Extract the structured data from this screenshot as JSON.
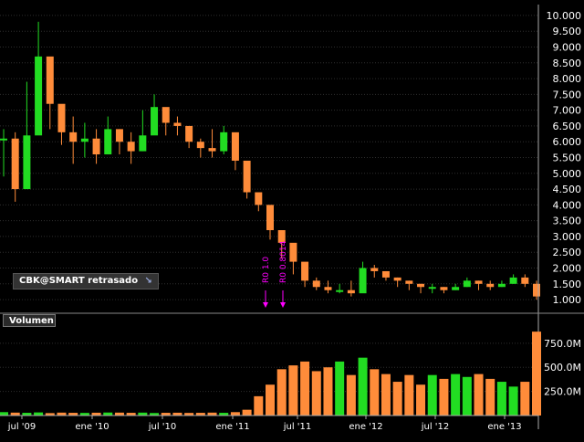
{
  "colors": {
    "up": "#22dd22",
    "down": "#ff8c3a",
    "grid": "#2e2e2e",
    "annotation": "#ff00ff",
    "axis": "#aaaaaa"
  },
  "symbol_badge": {
    "text": "CBK@SMART retrasado",
    "icon": "pointer-icon"
  },
  "volume_panel": {
    "title": "Volumen"
  },
  "chart_data": [
    {
      "type": "candlestick",
      "x_ticks": [
        "jul '09",
        "ene '10",
        "jul '10",
        "ene '11",
        "jul '11",
        "ene '12",
        "jul '12",
        "ene '13"
      ],
      "y_ticks": [
        "1.000",
        "1.500",
        "2.000",
        "2.500",
        "3.000",
        "3.500",
        "4.000",
        "4.500",
        "5.000",
        "5.500",
        "6.000",
        "6.500",
        "7.000",
        "7.500",
        "8.000",
        "8.500",
        "9.000",
        "9.500",
        "10.000"
      ],
      "ylim": [
        0.8,
        10.2
      ],
      "x": [
        "2009-05",
        "2009-06",
        "2009-07",
        "2009-08",
        "2009-09",
        "2009-10",
        "2009-11",
        "2009-12",
        "2010-01",
        "2010-02",
        "2010-03",
        "2010-04",
        "2010-05",
        "2010-06",
        "2010-07",
        "2010-08",
        "2010-09",
        "2010-10",
        "2010-11",
        "2010-12",
        "2011-01",
        "2011-02",
        "2011-03",
        "2011-04",
        "2011-05",
        "2011-06",
        "2011-07",
        "2011-08",
        "2011-09",
        "2011-10",
        "2011-11",
        "2011-12",
        "2012-01",
        "2012-02",
        "2012-03",
        "2012-04",
        "2012-05",
        "2012-06",
        "2012-07",
        "2012-08",
        "2012-09",
        "2012-10",
        "2012-11",
        "2012-12",
        "2013-01",
        "2013-02",
        "2013-03"
      ],
      "close": [
        6.1,
        4.5,
        6.2,
        8.7,
        7.2,
        6.3,
        6.0,
        6.1,
        5.6,
        6.4,
        6.0,
        5.7,
        6.2,
        7.1,
        6.6,
        6.5,
        6.0,
        5.8,
        5.7,
        6.3,
        5.4,
        4.4,
        4.0,
        3.2,
        2.8,
        2.2,
        1.6,
        1.4,
        1.3,
        1.3,
        1.2,
        2.0,
        1.9,
        1.7,
        1.6,
        1.5,
        1.4,
        1.4,
        1.3,
        1.4,
        1.6,
        1.5,
        1.4,
        1.5,
        1.7,
        1.5,
        1.1
      ],
      "high": [
        6.4,
        6.3,
        7.9,
        9.8,
        8.6,
        6.9,
        6.8,
        6.6,
        6.4,
        6.8,
        6.4,
        6.3,
        7.0,
        7.5,
        7.0,
        6.8,
        6.3,
        6.1,
        6.4,
        6.5,
        5.6,
        4.8,
        4.2,
        3.4,
        3.2,
        2.6,
        2.0,
        1.7,
        1.6,
        1.5,
        1.6,
        2.2,
        2.1,
        1.9,
        1.7,
        1.6,
        1.5,
        1.5,
        1.4,
        1.5,
        1.7,
        1.6,
        1.6,
        1.6,
        1.8,
        1.8,
        1.6
      ],
      "low": [
        4.9,
        4.1,
        4.5,
        7.0,
        6.4,
        5.9,
        5.3,
        5.5,
        5.3,
        5.6,
        5.6,
        5.3,
        5.7,
        6.3,
        6.2,
        6.2,
        5.8,
        5.5,
        5.5,
        5.6,
        5.1,
        4.2,
        3.8,
        2.9,
        2.3,
        1.8,
        1.4,
        1.3,
        1.2,
        1.2,
        1.1,
        1.8,
        1.7,
        1.6,
        1.4,
        1.3,
        1.2,
        1.2,
        1.2,
        1.3,
        1.4,
        1.3,
        1.3,
        1.4,
        1.5,
        1.4,
        1.0
      ],
      "annotations": [
        "R0 1.0",
        "R0 0.8014"
      ]
    },
    {
      "type": "bar",
      "title": "Volumen",
      "y_ticks": [
        "250.0M",
        "500.0M",
        "750.0M"
      ],
      "ylim": [
        0,
        900
      ],
      "values": [
        35,
        30,
        28,
        32,
        25,
        30,
        28,
        27,
        29,
        31,
        30,
        28,
        30,
        26,
        28,
        29,
        27,
        28,
        30,
        28,
        35,
        60,
        200,
        320,
        480,
        520,
        560,
        460,
        500,
        560,
        420,
        600,
        480,
        430,
        350,
        420,
        320,
        420,
        380,
        430,
        400,
        430,
        380,
        350,
        300,
        350,
        870
      ]
    }
  ]
}
